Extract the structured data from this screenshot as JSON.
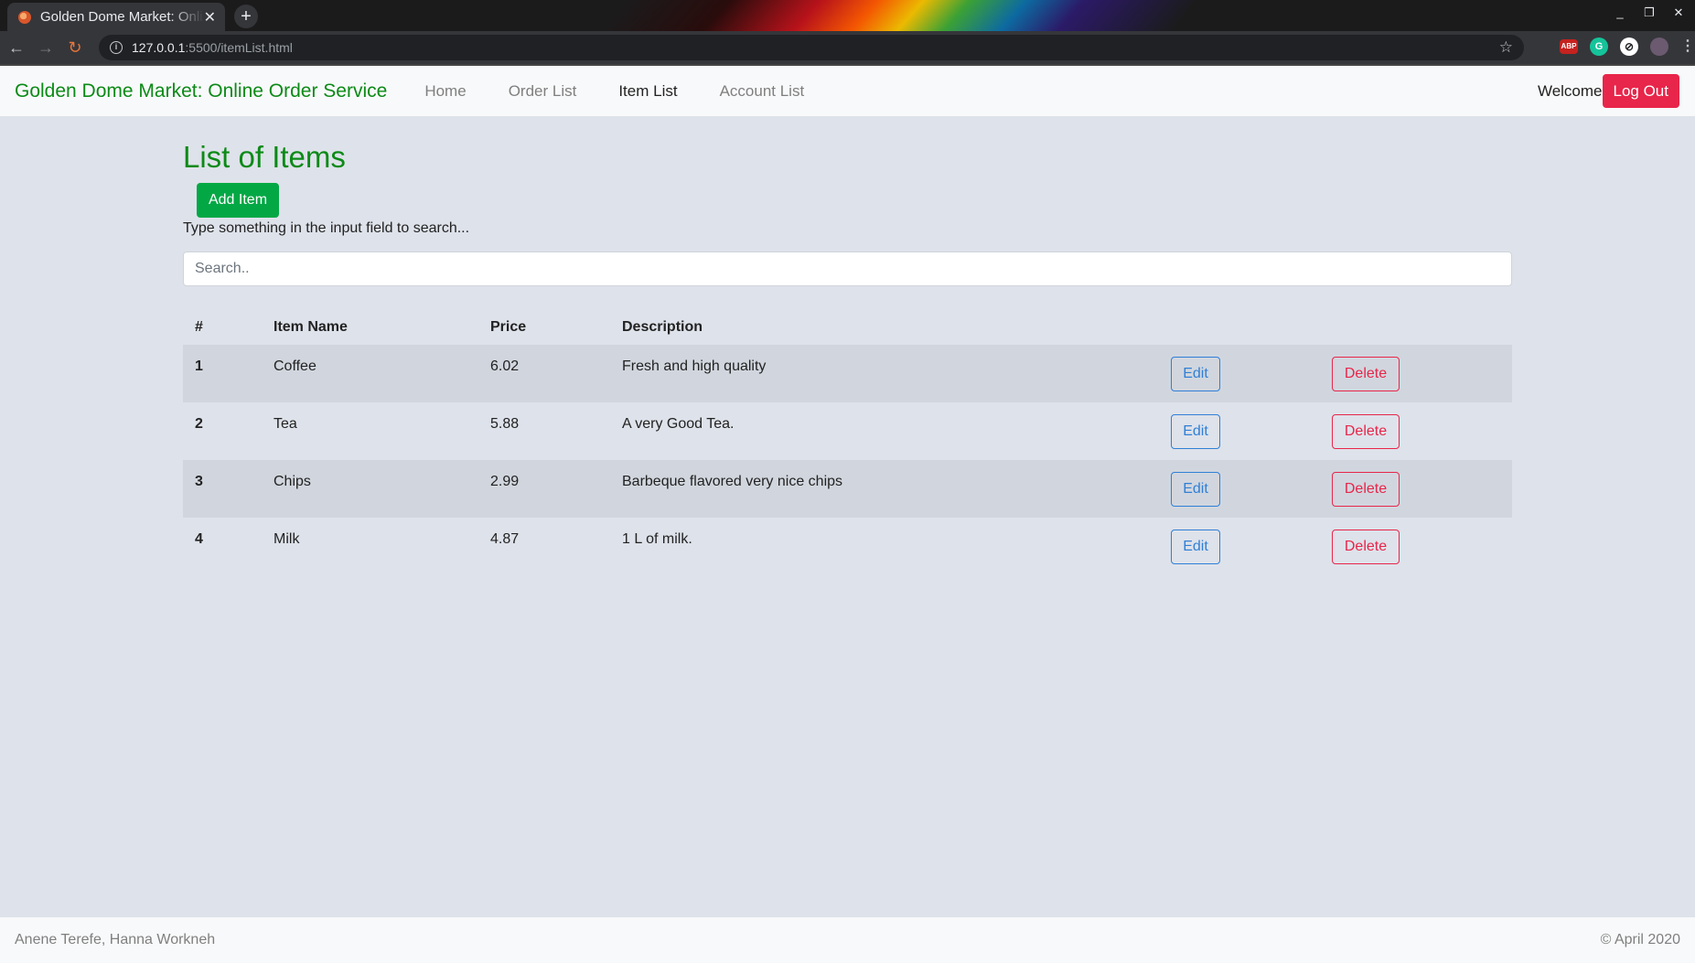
{
  "browser": {
    "tab_title": "Golden Dome Market: Online Order Service",
    "tab_close": "✕",
    "new_tab": "+",
    "url_host": "127.0.0.1",
    "url_path": ":5500/itemList.html",
    "window_controls": [
      "_",
      "❐",
      "✕"
    ]
  },
  "navbar": {
    "brand": "Golden Dome Market: Online Order Service",
    "links": [
      {
        "label": "Home",
        "active": false
      },
      {
        "label": "Order List",
        "active": false
      },
      {
        "label": "Item List",
        "active": true
      },
      {
        "label": "Account List",
        "active": false
      }
    ],
    "welcome": "Welcome",
    "logout_label": "Log Out"
  },
  "main": {
    "title": "List of Items",
    "add_button": "Add Item",
    "hint": "Type something in the input field to search...",
    "search_placeholder": "Search..",
    "table": {
      "headers": [
        "#",
        "Item Name",
        "Price",
        "Description"
      ],
      "rows": [
        {
          "num": "1",
          "name": "Coffee",
          "price": "6.02",
          "description": "Fresh and high quality",
          "edit": "Edit",
          "delete": "Delete"
        },
        {
          "num": "2",
          "name": "Tea",
          "price": "5.88",
          "description": "A very Good Tea.",
          "edit": "Edit",
          "delete": "Delete"
        },
        {
          "num": "3",
          "name": "Chips",
          "price": "2.99",
          "description": "Barbeque flavored very nice chips",
          "edit": "Edit",
          "delete": "Delete"
        },
        {
          "num": "4",
          "name": "Milk",
          "price": "4.87",
          "description": "1 L of milk.",
          "edit": "Edit",
          "delete": "Delete"
        }
      ]
    }
  },
  "footer": {
    "authors": "Anene Terefe, Hanna Workneh",
    "copyright": "© April 2020"
  },
  "colors": {
    "brand_green": "#0c8a17",
    "add_button": "#03a845",
    "danger": "#e8254a",
    "primary": "#2f7fd6",
    "page_bg": "#dee2ea"
  }
}
